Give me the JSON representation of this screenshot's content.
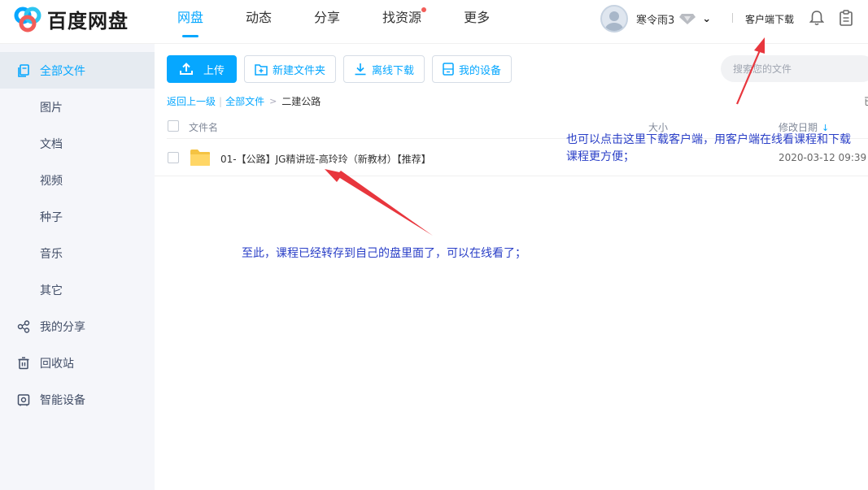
{
  "header": {
    "logo_text": "百度网盘",
    "nav": [
      {
        "label": "网盘",
        "active": true
      },
      {
        "label": "动态",
        "active": false
      },
      {
        "label": "分享",
        "active": false
      },
      {
        "label": "找资源",
        "active": false,
        "dot": true
      },
      {
        "label": "更多",
        "active": false
      }
    ],
    "username": "寒令雨3",
    "client_download": "客户端下载"
  },
  "sidebar": {
    "items": [
      {
        "label": "全部文件",
        "icon": "files-icon",
        "active": true
      },
      {
        "label": "图片"
      },
      {
        "label": "文档"
      },
      {
        "label": "视频"
      },
      {
        "label": "种子"
      },
      {
        "label": "音乐"
      },
      {
        "label": "其它"
      },
      {
        "label": "我的分享",
        "icon": "share-icon"
      },
      {
        "label": "回收站",
        "icon": "trash-icon"
      },
      {
        "label": "智能设备",
        "icon": "device-icon"
      }
    ]
  },
  "toolbar": {
    "upload": "上传",
    "new_folder": "新建文件夹",
    "offline_download": "离线下载",
    "my_devices": "我的设备",
    "search_placeholder": "搜索您的文件"
  },
  "breadcrumb": {
    "back": "返回上一级",
    "all_files": "全部文件",
    "current": "二建公路",
    "edge_char": "已"
  },
  "table": {
    "columns": {
      "name": "文件名",
      "size": "大小",
      "date": "修改日期"
    },
    "rows": [
      {
        "name": "01-【公路】JG精讲班-高玲玲（新教材）【推荐】",
        "size": "",
        "date": "2020-03-12 09:39"
      }
    ]
  },
  "annotations": {
    "note1": "也可以点击这里下载客户端，用客户端在线看课程和下载课程更方便；",
    "note2": "至此，课程已经转存到自己的盘里面了，可以在线看了；"
  },
  "colors": {
    "accent": "#06a7ff",
    "annotation": "#2a3fc7",
    "arrow": "#e8363d"
  }
}
